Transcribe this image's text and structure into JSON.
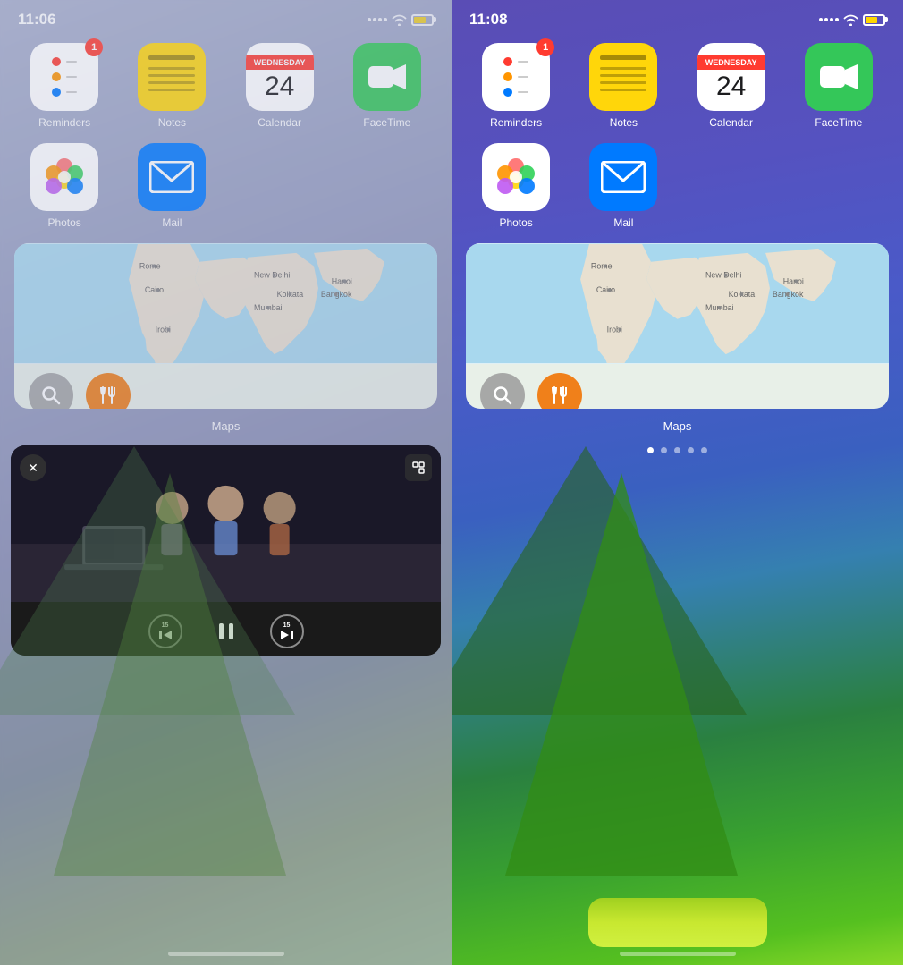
{
  "left": {
    "statusBar": {
      "time": "11:06",
      "signal": "····",
      "wifi": true,
      "battery": 70
    },
    "apps_row1": [
      {
        "id": "reminders",
        "label": "Reminders",
        "badge": "1"
      },
      {
        "id": "notes",
        "label": "Notes",
        "badge": null
      },
      {
        "id": "calendar",
        "label": "Calendar",
        "badge": null,
        "calDay": "Wednesday",
        "calDate": "24"
      },
      {
        "id": "facetime",
        "label": "FaceTime",
        "badge": null
      }
    ],
    "apps_row2": [
      {
        "id": "photos",
        "label": "Photos",
        "badge": null
      },
      {
        "id": "mail",
        "label": "Mail",
        "badge": null
      }
    ],
    "mapsWidget": {
      "label": "Maps",
      "cities": [
        "Rome",
        "Cairo",
        "New Delhi",
        "Kolkata",
        "Mumbai",
        "Hanoi",
        "Bangkok",
        "Irobi"
      ]
    },
    "videoPlayer": {
      "closeLabel": "✕",
      "skipBack": "15",
      "skipForward": "15"
    }
  },
  "right": {
    "statusBar": {
      "time": "11:08",
      "signal": "····",
      "wifi": true,
      "battery": 70
    },
    "apps_row1": [
      {
        "id": "reminders",
        "label": "Reminders",
        "badge": "1"
      },
      {
        "id": "notes",
        "label": "Notes",
        "badge": null
      },
      {
        "id": "calendar",
        "label": "Calendar",
        "badge": null,
        "calDay": "Wednesday",
        "calDate": "24"
      },
      {
        "id": "facetime",
        "label": "FaceTime",
        "badge": null
      }
    ],
    "apps_row2": [
      {
        "id": "photos",
        "label": "Photos",
        "badge": null
      },
      {
        "id": "mail",
        "label": "Mail",
        "badge": null
      }
    ],
    "mapsWidget": {
      "label": "Maps",
      "cities": [
        "Rome",
        "Cairo",
        "New Delhi",
        "Kolkata",
        "Mumbai",
        "Hanoi",
        "Bangkok",
        "Irobi"
      ]
    },
    "pageDots": [
      true,
      false,
      false,
      false,
      false
    ]
  }
}
